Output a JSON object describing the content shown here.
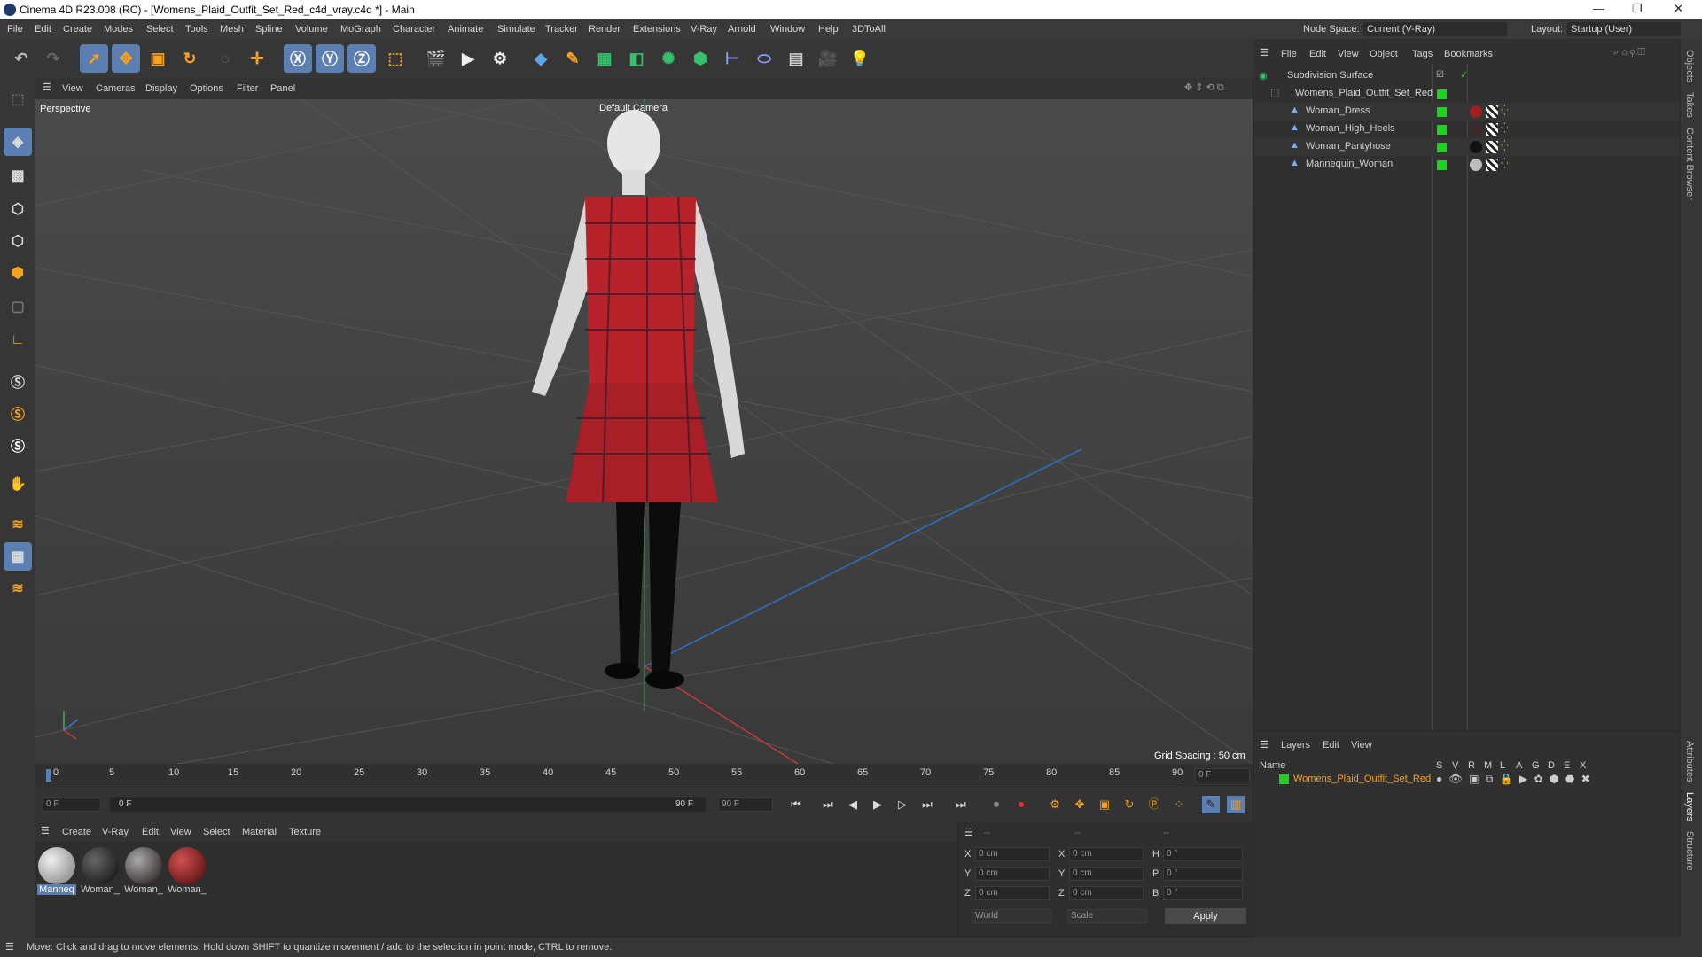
{
  "window": {
    "title": "Cinema 4D R23.008 (RC) - [Womens_Plaid_Outfit_Set_Red_c4d_vray.c4d *] - Main",
    "min": "—",
    "max": "❐",
    "close": "✕"
  },
  "menubar": {
    "items": [
      "File",
      "Edit",
      "Create",
      "Modes",
      "Select",
      "Tools",
      "Mesh",
      "Spline",
      "Volume",
      "MoGraph",
      "Character",
      "Animate",
      "Simulate",
      "Tracker",
      "Render",
      "Extensions",
      "V-Ray",
      "Arnold",
      "Window",
      "Help",
      "3DToAll"
    ],
    "node_space_label": "Node Space:",
    "node_space_value": "Current (V-Ray)",
    "layout_label": "Layout:",
    "layout_value": "Startup (User)"
  },
  "viewport": {
    "menu": [
      "View",
      "Cameras",
      "Display",
      "Options",
      "Filter",
      "Panel"
    ],
    "view_name": "Perspective",
    "camera": "Default Camera",
    "grid_spacing": "Grid Spacing : 50 cm"
  },
  "timeline": {
    "ticks": [
      "0",
      "5",
      "10",
      "15",
      "20",
      "25",
      "30",
      "35",
      "40",
      "45",
      "50",
      "55",
      "60",
      "65",
      "70",
      "75",
      "80",
      "85",
      "90"
    ],
    "end_field": "0 F"
  },
  "playbar": {
    "start": "0 F",
    "range_start": "0 F",
    "range_end": "90 F",
    "end": "90 F"
  },
  "materials": {
    "menu": [
      "Create",
      "V-Ray",
      "Edit",
      "View",
      "Select",
      "Material",
      "Texture"
    ],
    "items": [
      {
        "label": "Manneq",
        "color": "#bdbdbd"
      },
      {
        "label": "Woman_",
        "color": "#1c1c1c"
      },
      {
        "label": "Woman_",
        "color": "#3a2a2a"
      },
      {
        "label": "Woman_",
        "color": "#a02020"
      }
    ]
  },
  "coords": {
    "headers": [
      "--",
      "--",
      "--"
    ],
    "rows": [
      {
        "a": "X",
        "av": "0 cm",
        "b": "X",
        "bv": "0 cm",
        "c": "H",
        "cv": "0 °"
      },
      {
        "a": "Y",
        "av": "0 cm",
        "b": "Y",
        "bv": "0 cm",
        "c": "P",
        "cv": "0 °"
      },
      {
        "a": "Z",
        "av": "0 cm",
        "b": "Z",
        "bv": "0 cm",
        "c": "B",
        "cv": "0 °"
      }
    ],
    "world": "World",
    "scale": "Scale",
    "apply": "Apply"
  },
  "objects": {
    "menu": [
      "File",
      "Edit",
      "View",
      "Object",
      "Tags",
      "Bookmarks"
    ],
    "items": [
      "Subdivision Surface",
      "Womens_Plaid_Outfit_Set_Red",
      "Woman_Dress",
      "Woman_High_Heels",
      "Woman_Pantyhose",
      "Mannequin_Woman"
    ]
  },
  "layers": {
    "menu": [
      "Layers",
      "Edit",
      "View"
    ],
    "name_header": "Name",
    "cols": [
      "S",
      "V",
      "R",
      "M",
      "L",
      "A",
      "G",
      "D",
      "E",
      "X"
    ],
    "layer_name": "Womens_Plaid_Outfit_Set_Red"
  },
  "right_tabs": [
    "Objects",
    "Takes",
    "Content Browser",
    "Attributes",
    "Layers",
    "Structure"
  ],
  "status": "Move: Click and drag to move elements. Hold down SHIFT to quantize movement / add to the selection in point mode, CTRL to remove."
}
